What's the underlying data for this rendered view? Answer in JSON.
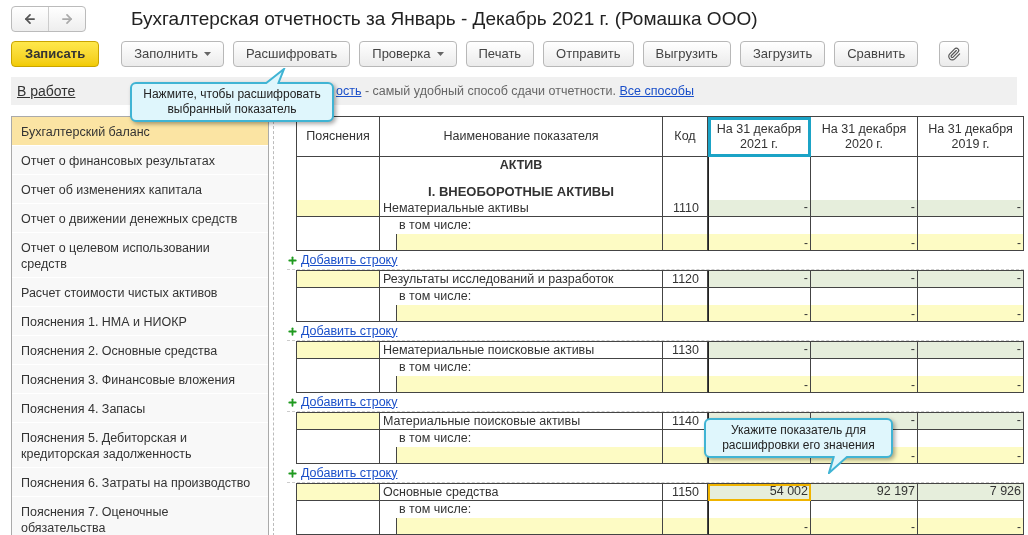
{
  "window": {
    "title": "Бухгалтерская отчетность за Январь - Декабрь 2021 г. (Ромашка ООО)"
  },
  "toolbar": {
    "buttons": [
      {
        "label": "Записать",
        "kind": "primary"
      },
      {
        "label": "Заполнить",
        "kind": "dropdown"
      },
      {
        "label": "Расшифровать",
        "kind": "plain"
      },
      {
        "label": "Проверка",
        "kind": "dropdown"
      },
      {
        "label": "Печать",
        "kind": "plain"
      },
      {
        "label": "Отправить",
        "kind": "plain"
      },
      {
        "label": "Выгрузить",
        "kind": "plain"
      },
      {
        "label": "Загрузить",
        "kind": "plain"
      },
      {
        "label": "Сравнить",
        "kind": "plain"
      },
      {
        "kind": "attach"
      }
    ]
  },
  "status_link": "В работе",
  "info_bar": {
    "link": "ость",
    "text": " - самый удобный способ сдачи отчетности. ",
    "link2": "Все способы"
  },
  "tooltips": [
    {
      "text": "Нажмите, чтобы расшифровать выбранный показатель",
      "kind": "up"
    },
    {
      "text": "Укажите показатель для расшифровки его значения",
      "kind": "down"
    }
  ],
  "sidebar": {
    "items": [
      {
        "label": "Бухгалтерский баланс",
        "selected": true
      },
      {
        "label": "Отчет о финансовых результатах",
        "selected": false
      },
      {
        "label": "Отчет об изменениях капитала",
        "selected": false
      },
      {
        "label": "Отчет о движении денежных средств",
        "selected": false
      },
      {
        "label": "Отчет о целевом использовании средств",
        "selected": false
      },
      {
        "label": "Расчет стоимости чистых активов",
        "selected": false
      },
      {
        "label": "Пояснения 1. НМА и НИОКР",
        "selected": false
      },
      {
        "label": "Пояснения 2. Основные средства",
        "selected": false
      },
      {
        "label": "Пояснения 3. Финансовые вложения",
        "selected": false
      },
      {
        "label": "Пояснения 4. Запасы",
        "selected": false
      },
      {
        "label": "Пояснения 5. Дебиторская и кредиторская задолженность",
        "selected": false
      },
      {
        "label": "Пояснения 6. Затраты на производство",
        "selected": false
      },
      {
        "label": "Пояснения 7. Оценочные обязательства",
        "selected": false
      }
    ]
  },
  "table": {
    "columns": [
      {
        "label": "Пояснения",
        "selected": false
      },
      {
        "label": "Наименование показателя",
        "selected": false
      },
      {
        "label": "Код",
        "selected": false
      },
      {
        "label": "На 31 декабря 2021 г.",
        "selected": true
      },
      {
        "label": "На 31 декабря 2020 г.",
        "selected": false
      },
      {
        "label": "На 31 декабря 2019 г.",
        "selected": false
      }
    ],
    "section": "АКТИВ",
    "subsection": "I. ВНЕОБОРОТНЫЕ АКТИВЫ",
    "blocks": [
      {
        "name": "Нематериальные активы",
        "code": "1110",
        "values": [
          {
            "text": "-",
            "selected": false
          },
          {
            "text": "-",
            "selected": false
          },
          {
            "text": "-",
            "selected": false
          }
        ],
        "sub_label": "в том числе:",
        "sub_values": [
          "-",
          "-",
          "-"
        ],
        "add_link": "Добавить строку"
      },
      {
        "name": "Результаты исследований и разработок",
        "code": "1120",
        "values": [
          {
            "text": "-",
            "selected": false
          },
          {
            "text": "-",
            "selected": false
          },
          {
            "text": "-",
            "selected": false
          }
        ],
        "sub_label": "в том числе:",
        "sub_values": [
          "-",
          "-",
          "-"
        ],
        "add_link": "Добавить строку"
      },
      {
        "name": "Нематериальные поисковые активы",
        "code": "1130",
        "values": [
          {
            "text": "-",
            "selected": false
          },
          {
            "text": "-",
            "selected": false
          },
          {
            "text": "-",
            "selected": false
          }
        ],
        "sub_label": "в том числе:",
        "sub_values": [
          "-",
          "-",
          "-"
        ],
        "add_link": "Добавить строку"
      },
      {
        "name": "Материальные поисковые активы",
        "code": "1140",
        "values": [
          {
            "text": "-",
            "selected": false
          },
          {
            "text": "-",
            "selected": false
          }
        ],
        "sub_label": "в том числе:",
        "sub_values": [
          "-",
          "-"
        ],
        "add_link": "Добавить строку"
      },
      {
        "name": "Основные средства",
        "code": "1150",
        "values": [
          {
            "text": "54 002",
            "selected": true
          },
          {
            "text": "92 197",
            "selected": false
          },
          {
            "text": "7 926",
            "selected": false
          }
        ],
        "sub_label": "в том числе:",
        "sub_values": [
          "-",
          "-",
          "-"
        ]
      }
    ]
  }
}
